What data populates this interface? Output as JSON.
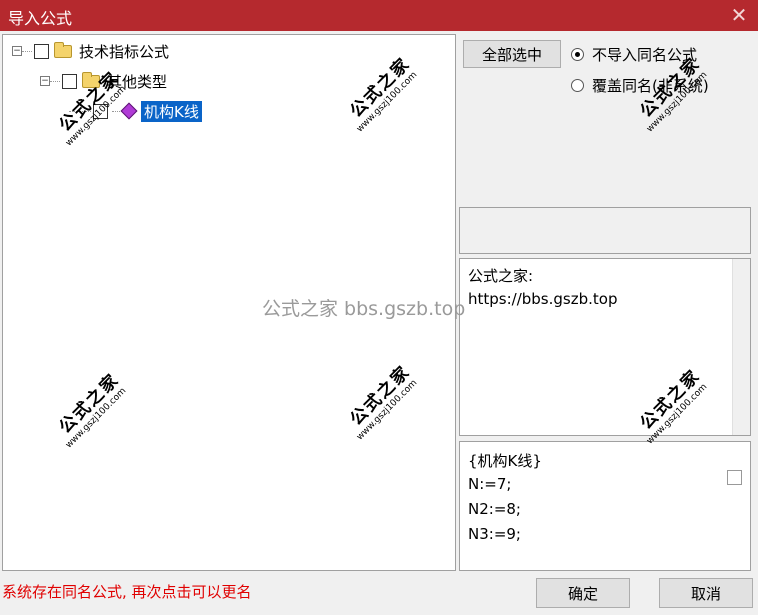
{
  "window": {
    "title": "导入公式",
    "close_glyph": "✕"
  },
  "tree": {
    "root": {
      "label": "技术指标公式",
      "expander": "−"
    },
    "group": {
      "label": "其他类型",
      "expander": "−"
    },
    "item": {
      "label": "机构K线"
    }
  },
  "controls": {
    "select_all": "全部选中",
    "radio_no_import": "不导入同名公式",
    "radio_overwrite": "覆盖同名(非系统)"
  },
  "info": {
    "line1": "公式之家:",
    "line2": "https://bbs.gszb.top"
  },
  "formula": {
    "line1": "{机构K线}",
    "line2": "N:=7;",
    "line3": "N2:=8;",
    "line4": "N3:=9;"
  },
  "status": "系统存在同名公式, 再次点击可以更名",
  "buttons": {
    "ok": "确定",
    "cancel": "取消"
  },
  "watermarks": {
    "main": "公式之家",
    "url": "www.gszj100.com",
    "center": "公式之家 bbs.gszb.top"
  },
  "colors": {
    "titlebar": "#b5292e",
    "selection": "#0a64c8",
    "status": "#e00000"
  }
}
